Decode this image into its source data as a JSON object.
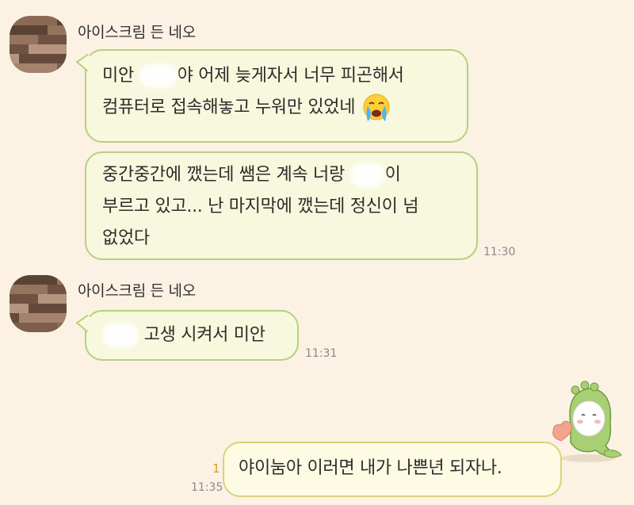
{
  "chat": {
    "groups": [
      {
        "sender": "아이스크림 든 네오",
        "messages": [
          {
            "line1_before": "미안 ",
            "line1_after": "야 어제 늦게자서 너무 피곤해서",
            "line2": "컴퓨터로 접속해놓고 누워만 있었네",
            "emoji": "crying-face-icon"
          },
          {
            "line1_before": "중간중간에 깼는데 쌤은 계속 너랑 ",
            "line1_after": "이",
            "line2": "부르고 있고... 난 마지막에 깼는데 정신이 넘",
            "line3": "없었다",
            "time": "11:30"
          }
        ]
      },
      {
        "sender": "아이스크림 든 네오",
        "messages": [
          {
            "text_after": "고생 시켜서 미안",
            "time": "11:31"
          }
        ]
      }
    ],
    "outgoing": {
      "unread_count": "1",
      "text": "야이눔아 이러면 내가 나쁜년 되자나.",
      "time": "11:35",
      "sticker": "dino-neo-heart-sticker"
    }
  },
  "colors": {
    "background": "#fbf2e4",
    "bubble_fill": "#f7f8dd",
    "bubble_border": "#b8cf7e",
    "outgoing_fill": "#fdfbe4",
    "outgoing_border": "#d9d27a"
  }
}
